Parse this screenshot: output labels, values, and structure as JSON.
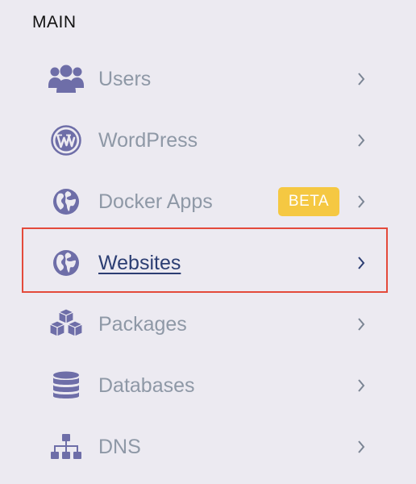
{
  "section": {
    "title": "MAIN"
  },
  "colors": {
    "icon": "#6e6ea8",
    "label_inactive": "#8e98a6",
    "label_active": "#2c3e73",
    "chevron": "#7b8594",
    "chevron_active": "#2c3e73",
    "badge_bg": "#f5c842",
    "highlight_border": "#e44a3b",
    "background": "#eceaf1"
  },
  "menu": {
    "items": [
      {
        "label": "Users",
        "icon": "users-icon",
        "active": false
      },
      {
        "label": "WordPress",
        "icon": "wordpress-icon",
        "active": false
      },
      {
        "label": "Docker Apps",
        "icon": "globe-icon",
        "active": false,
        "badge": "BETA"
      },
      {
        "label": "Websites",
        "icon": "globe-icon",
        "active": true
      },
      {
        "label": "Packages",
        "icon": "packages-icon",
        "active": false
      },
      {
        "label": "Databases",
        "icon": "database-icon",
        "active": false
      },
      {
        "label": "DNS",
        "icon": "sitemap-icon",
        "active": false
      }
    ]
  }
}
